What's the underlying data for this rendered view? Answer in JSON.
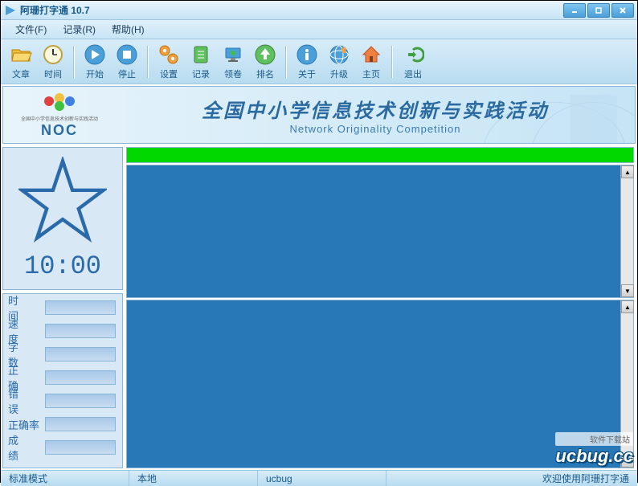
{
  "window": {
    "title": "阿珊打字通 10.7"
  },
  "menu": {
    "file": "文件(F)",
    "record": "记录(R)",
    "help": "帮助(H)"
  },
  "toolbar": {
    "article": "文章",
    "time": "时间",
    "start": "开始",
    "stop": "停止",
    "settings": "设置",
    "records": "记录",
    "collect": "领卷",
    "rank": "排名",
    "about": "关于",
    "upgrade": "升级",
    "home": "主页",
    "exit": "退出"
  },
  "banner": {
    "logo_sub": "全国中小学信息技术创新与实践活动",
    "noc": "NOC",
    "title_cn": "全国中小学信息技术创新与实践活动",
    "title_en": "Network Originality Competition"
  },
  "timer": "10:00",
  "stats": {
    "time": {
      "label": "时　间",
      "value": ""
    },
    "speed": {
      "label": "速　度",
      "value": ""
    },
    "chars": {
      "label": "字　数",
      "value": ""
    },
    "correct": {
      "label": "正　确",
      "value": ""
    },
    "errors": {
      "label": "错　误",
      "value": ""
    },
    "accuracy": {
      "label": "正确率",
      "value": ""
    },
    "score": {
      "label": "成　绩",
      "value": ""
    }
  },
  "status": {
    "mode": "标准模式",
    "location": "本地",
    "user": "ucbug",
    "welcome": "欢迎使用阿珊打字通"
  },
  "watermark": {
    "sub": "软件下载站",
    "main": "ucbug.cc"
  }
}
